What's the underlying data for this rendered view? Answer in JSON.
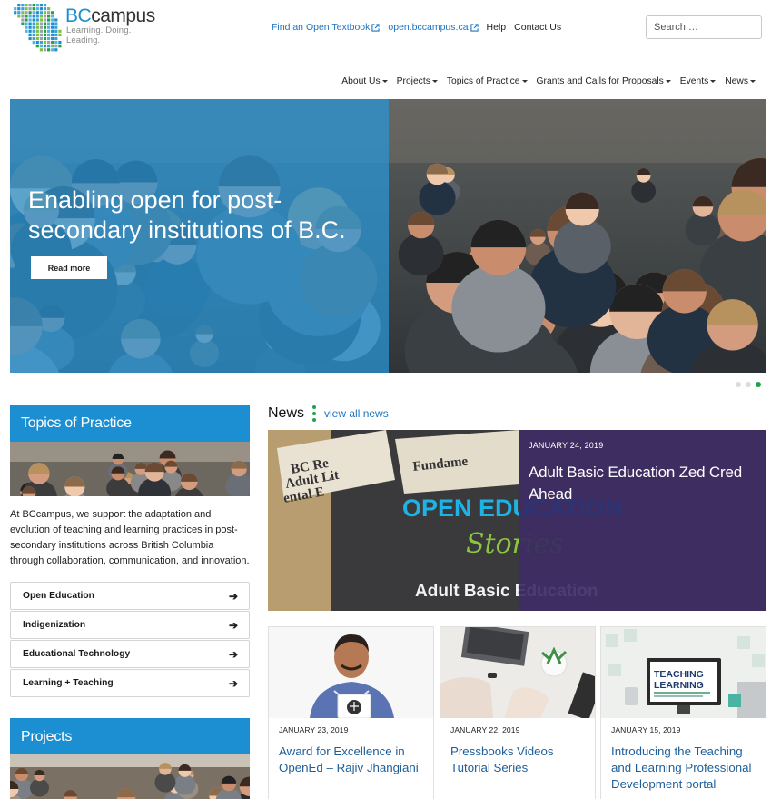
{
  "header": {
    "logo": {
      "name_prefix": "BC",
      "name_suffix": "campus",
      "tagline": "Learning. Doing. Leading."
    },
    "top_links": [
      "Find an Open Textbook",
      "open.bccampus.ca",
      "Help",
      "Contact Us"
    ],
    "search_placeholder": "Search …"
  },
  "nav": {
    "items": [
      "About Us",
      "Projects",
      "Topics of Practice",
      "Grants and Calls for Proposals",
      "Events",
      "News"
    ]
  },
  "hero": {
    "title": "Enabling open for post-secondary institutions of B.C.",
    "button": "Read more",
    "slides_total": 3,
    "active_slide": 3,
    "overlay_color": "#1b8fd1"
  },
  "topics": {
    "heading": "Topics of Practice",
    "description": "At BCcampus, we support the adaptation and evolution of teaching and learning practices in post-secondary institutions across British Columbia through collaboration, communication, and innovation.",
    "items": [
      "Open Education",
      "Indigenization",
      "Educational Technology",
      "Learning + Teaching"
    ]
  },
  "projects": {
    "heading": "Projects"
  },
  "news": {
    "heading": "News",
    "view_all": "view all news",
    "featured": {
      "date": "JANUARY 24, 2019",
      "title": "Adult Basic Education Zed Cred Ahead",
      "image_text": {
        "line1": "OPEN EDUCATION",
        "line2": "Stories",
        "line3": "Adult Basic Education"
      }
    },
    "cards": [
      {
        "date": "JANUARY 23, 2019",
        "title": "Award for Excellence in OpenEd – Rajiv Jhangiani"
      },
      {
        "date": "JANUARY 22, 2019",
        "title": "Pressbooks Videos Tutorial Series"
      },
      {
        "date": "JANUARY 15, 2019",
        "title": "Introducing the Teaching and Learning Professional Development portal",
        "image_text": {
          "line1": "TEACHING",
          "line2": "LEARNING"
        }
      }
    ]
  },
  "colors": {
    "brand_blue": "#1b8fd1",
    "link_blue": "#1e73be",
    "accent_green": "#1fa34a",
    "feature_purple": "#30205f"
  }
}
